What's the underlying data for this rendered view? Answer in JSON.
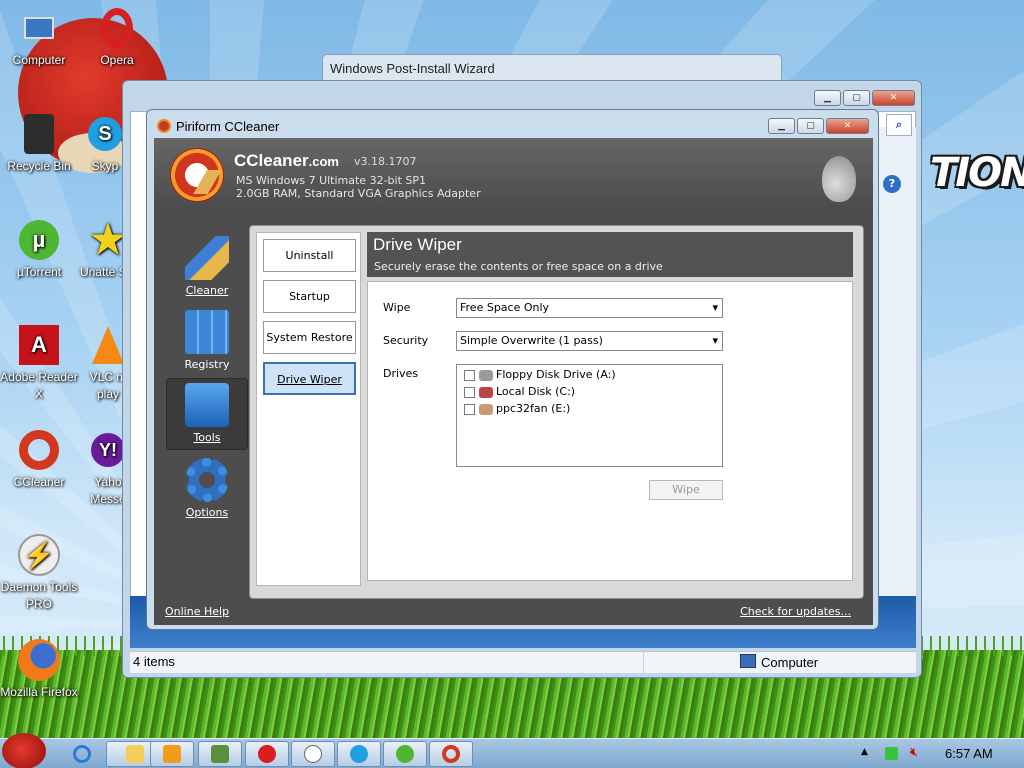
{
  "desktop": {
    "icons": [
      {
        "label": "Computer"
      },
      {
        "label": "Opera"
      },
      {
        "label": "Recycle Bin"
      },
      {
        "label": "Skyp"
      },
      {
        "label": "µTorrent"
      },
      {
        "label": "Unatte Sol"
      },
      {
        "label": "Adobe Reader X"
      },
      {
        "label": "VLC m play"
      },
      {
        "label": "CCleaner"
      },
      {
        "label": "Yaho Messe"
      },
      {
        "label": "Daemon Tools PRO"
      },
      {
        "label": "Mozilla Firefox"
      }
    ],
    "wallpaper_text": "TION"
  },
  "wizard": {
    "title": "Windows Post-Install Wizard"
  },
  "explorer": {
    "status_items": "4 items",
    "status_location": "Computer"
  },
  "ccleaner": {
    "title": "Piriform CCleaner",
    "app_name": "CCleaner",
    "app_domain": ".com",
    "version": "v3.18.1707",
    "sys_line1": "MS Windows 7 Ultimate 32-bit SP1",
    "sys_line2": "2.0GB RAM, Standard VGA Graphics Adapter",
    "nav": [
      {
        "label": "Cleaner"
      },
      {
        "label": "Registry"
      },
      {
        "label": "Tools"
      },
      {
        "label": "Options"
      }
    ],
    "tools_menu": [
      {
        "label": "Uninstall"
      },
      {
        "label": "Startup"
      },
      {
        "label": "System Restore"
      },
      {
        "label": "Drive Wiper"
      }
    ],
    "panel_title": "Drive Wiper",
    "panel_subtitle": "Securely erase the contents or free space on a drive",
    "wipe_label": "Wipe",
    "wipe_value": "Free Space Only",
    "security_label": "Security",
    "security_value": "Simple Overwrite (1 pass)",
    "drives_label": "Drives",
    "drives": [
      {
        "label": "Floppy Disk Drive (A:)"
      },
      {
        "label": "Local Disk (C:)"
      },
      {
        "label": "ppc32fan (E:)"
      }
    ],
    "wipe_button": "Wipe",
    "online_help": "Online Help",
    "check_updates": "Check for updates..."
  },
  "taskbar": {
    "clock": "6:57 AM"
  }
}
